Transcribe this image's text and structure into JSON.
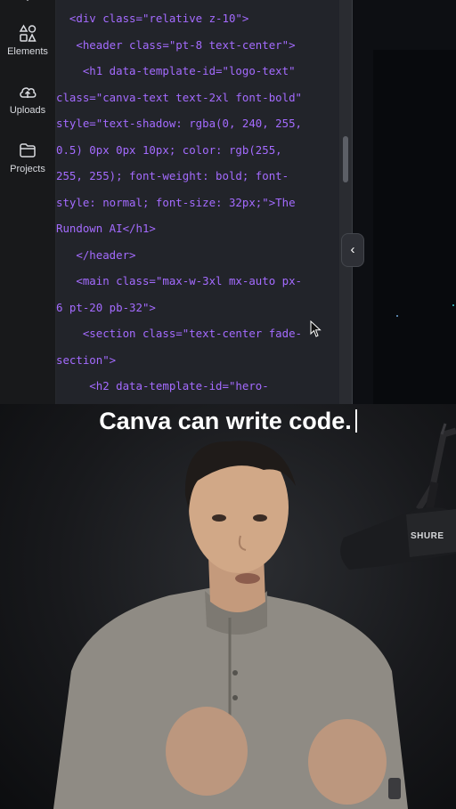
{
  "sidebar": {
    "items": [
      {
        "label": "Elements",
        "icon": "elements-icon"
      },
      {
        "label": "Uploads",
        "icon": "upload-cloud-icon"
      },
      {
        "label": "Projects",
        "icon": "folder-icon"
      }
    ]
  },
  "code_editor": {
    "lines": [
      "  <div class=\"relative z-10\">",
      "   <header class=\"pt-8 text-center\">",
      "    <h1 data-template-id=\"logo-text\"",
      "class=\"canva-text text-2xl font-bold\"",
      "style=\"text-shadow: rgba(0, 240, 255,",
      "0.5) 0px 0px 10px; color: rgb(255,",
      "255, 255); font-weight: bold; font-",
      "style: normal; font-size: 32px;\">The",
      "Rundown AI</h1>",
      "   </header>",
      "   <main class=\"max-w-3xl mx-auto px-",
      "6 pt-20 pb-32\">",
      "    <section class=\"text-center fade-",
      "section\">",
      "     <h2 data-template-id=\"hero-"
    ],
    "color": "#a46bff"
  },
  "collapse_button": {
    "glyph": "‹"
  },
  "video": {
    "caption": "Canva can write code.",
    "microphone_brand": "SHURE"
  },
  "colors": {
    "editor_bg": "#22242a",
    "sidebar_bg": "#18191b",
    "code_text": "#a46bff"
  }
}
